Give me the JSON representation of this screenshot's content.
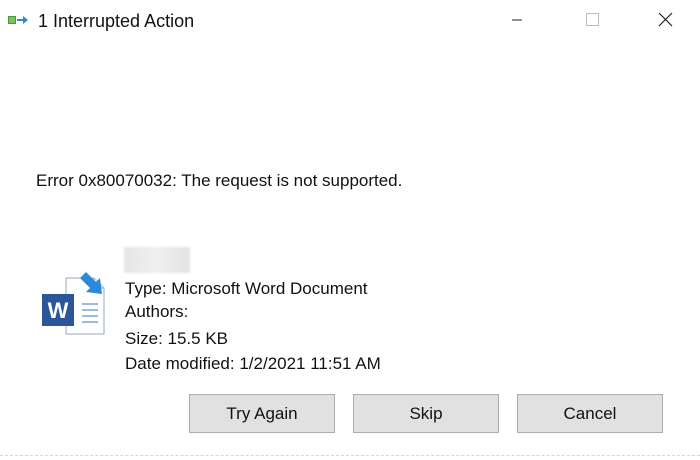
{
  "window": {
    "title": "1 Interrupted Action",
    "icon": "file-move-icon",
    "controls": [
      "minimize-icon",
      "maximize-icon",
      "close-icon"
    ]
  },
  "error": {
    "message": "Error 0x80070032: The request is not supported."
  },
  "file": {
    "icon": "word-document-icon",
    "type": "Type: Microsoft Word Document",
    "authors": "Authors:",
    "size": "Size: 15.5 KB",
    "date_modified": "Date modified: 1/2/2021 11:51 AM"
  },
  "buttons": {
    "try_again": "Try Again",
    "skip": "Skip",
    "cancel": "Cancel"
  },
  "colors": {
    "word_blue": "#2b579a",
    "button_face": "#e1e1e1",
    "button_border": "#adadad",
    "arrow_blue": "#2a8ad8"
  }
}
